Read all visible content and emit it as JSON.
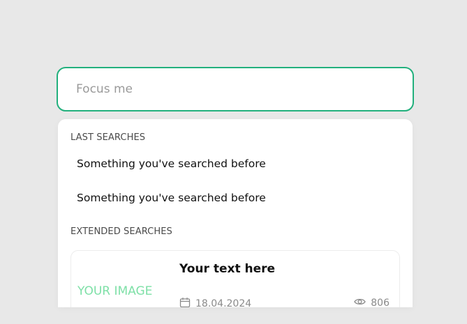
{
  "search": {
    "placeholder": "Focus me",
    "value": ""
  },
  "dropdown": {
    "last_searches_title": "LAST SEARCHES",
    "last_searches": [
      "Something you've searched before",
      "Something you've searched before"
    ],
    "extended_searches_title": "EXTENDED SEARCHES",
    "card": {
      "image_label": "YOUR IMAGE",
      "title": "Your text here",
      "date": "18.04.2024",
      "views": "806",
      "date_icon": "calendar-icon",
      "views_icon": "eye-icon"
    }
  },
  "colors": {
    "background": "#e8e8e8",
    "accent": "#22b07d",
    "image_placeholder": "#7ee0a7",
    "meta_text": "#8a8a8a"
  }
}
